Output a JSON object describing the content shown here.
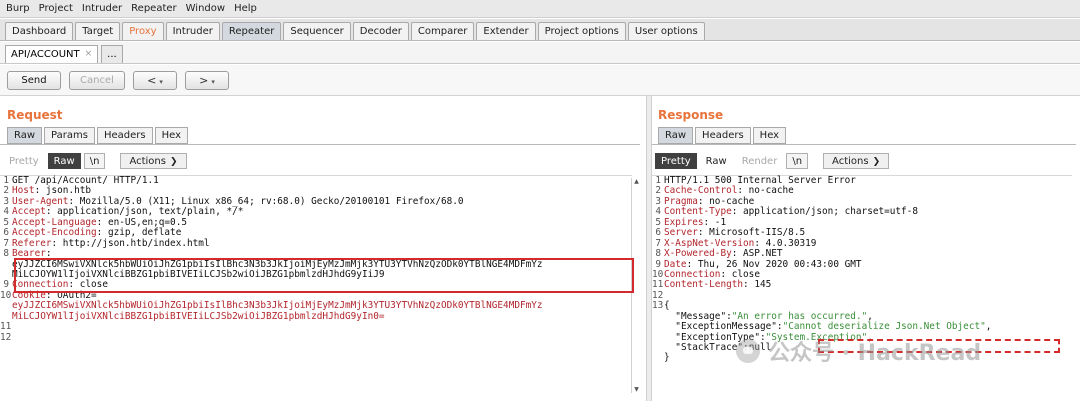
{
  "menu": [
    "Burp",
    "Project",
    "Intruder",
    "Repeater",
    "Window",
    "Help"
  ],
  "main_tabs": [
    "Dashboard",
    "Target",
    "Proxy",
    "Intruder",
    "Repeater",
    "Sequencer",
    "Decoder",
    "Comparer",
    "Extender",
    "Project options",
    "User options"
  ],
  "sub_tabs": {
    "active": "API/ACCOUNT",
    "close": "×",
    "more": "..."
  },
  "toolbar": {
    "send": "Send",
    "cancel": "Cancel",
    "back": "<",
    "forward": ">",
    "dropdown": "▾"
  },
  "request": {
    "title": "Request",
    "tabs": [
      "Raw",
      "Params",
      "Headers",
      "Hex"
    ],
    "view": {
      "pretty": "Pretty",
      "raw": "Raw",
      "newline": "\\n",
      "actions": "Actions"
    },
    "lines": [
      {
        "n": "1",
        "k": "",
        "v": "GET /api/Account/ HTTP/1.1"
      },
      {
        "n": "2",
        "k": "Host",
        "v": ": json.htb"
      },
      {
        "n": "3",
        "k": "User-Agent",
        "v": ": Mozilla/5.0 (X11; Linux x86_64; rv:68.0) Gecko/20100101 Firefox/68.0"
      },
      {
        "n": "4",
        "k": "Accept",
        "v": ": application/json, text/plain, */*"
      },
      {
        "n": "5",
        "k": "Accept-Language",
        "v": ": en-US,en;q=0.5"
      },
      {
        "n": "6",
        "k": "Accept-Encoding",
        "v": ": gzip, deflate"
      },
      {
        "n": "7",
        "k": "Referer",
        "v": ": http://json.htb/index.html"
      },
      {
        "n": "8",
        "k": "Bearer",
        "v": ":"
      },
      {
        "n": "",
        "k": "",
        "v": "eyJJZCI6MSwiVXNlck5hbWUiOiJhZG1pbiIsIlBhc3N3b3JkIjoiMjEyMzJmMjk3YTU3YTVhNzQzODk0YTBlNGE4MDFmYz"
      },
      {
        "n": "",
        "k": "",
        "v": "MiLCJOYW1lIjoiVXNlciBBZG1pbiBIVEIiLCJSb2wiOiJBZG1pbmlzdHJhdG9yIiJ9"
      },
      {
        "n": "9",
        "k": "Connection",
        "v": ": close"
      },
      {
        "n": "10",
        "k": "Cookie",
        "v": ": OAuth2="
      },
      {
        "n": "",
        "k": "",
        "v": "eyJJZCI6MSwiVXNlck5hbWUiOiJhZG1pbiIsIlBhc3N3b3JkIjoiMjEyMzJmMjk3YTU3YTVhNzQzODk0YTBlNGE4MDFmYz"
      },
      {
        "n": "",
        "k": "",
        "v": "MiLCJOYW1lIjoiVXNlciBBZG1pbiBIVEIiLCJSb2wiOiJBZG1pbmlzdHJhdG9yIn0="
      },
      {
        "n": "11",
        "k": "",
        "v": ""
      },
      {
        "n": "12",
        "k": "",
        "v": ""
      }
    ]
  },
  "response": {
    "title": "Response",
    "tabs": [
      "Raw",
      "Headers",
      "Hex"
    ],
    "view": {
      "pretty": "Pretty",
      "raw": "Raw",
      "render": "Render",
      "newline": "\\n",
      "actions": "Actions"
    },
    "lines": [
      {
        "n": "1",
        "k": "",
        "v": "HTTP/1.1 500 Internal Server Error"
      },
      {
        "n": "2",
        "k": "Cache-Control",
        "v": ": no-cache"
      },
      {
        "n": "3",
        "k": "Pragma",
        "v": ": no-cache"
      },
      {
        "n": "4",
        "k": "Content-Type",
        "v": ": application/json; charset=utf-8"
      },
      {
        "n": "5",
        "k": "Expires",
        "v": ": -1"
      },
      {
        "n": "6",
        "k": "Server",
        "v": ": Microsoft-IIS/8.5"
      },
      {
        "n": "7",
        "k": "X-AspNet-Version",
        "v": ": 4.0.30319"
      },
      {
        "n": "8",
        "k": "X-Powered-By",
        "v": ": ASP.NET"
      },
      {
        "n": "9",
        "k": "Date",
        "v": ": Thu, 26 Nov 2020 00:43:00 GMT"
      },
      {
        "n": "10",
        "k": "Connection",
        "v": ": close"
      },
      {
        "n": "11",
        "k": "Content-Length",
        "v": ": 145"
      },
      {
        "n": "12",
        "k": "",
        "v": ""
      },
      {
        "n": "13",
        "k": "",
        "v": "{"
      }
    ],
    "json": [
      {
        "k": "\"Message\"",
        "v": "\"An error has occurred.\"",
        "t": "str"
      },
      {
        "k": "\"ExceptionMessage\"",
        "v": "\"Cannot deserialize Json.Net Object\"",
        "t": "str"
      },
      {
        "k": "\"ExceptionType\"",
        "v": "\"System.Exception\"",
        "t": "str"
      },
      {
        "k": "\"StackTrace\"",
        "v": "null",
        "t": "null"
      }
    ],
    "close_brace": "}"
  },
  "watermark": "公众号 · HackRead",
  "colors": {
    "accent": "#e8733b",
    "highlight": "#d32b2b",
    "header_key": "#b2262d",
    "json_string": "#3b8f3b"
  }
}
